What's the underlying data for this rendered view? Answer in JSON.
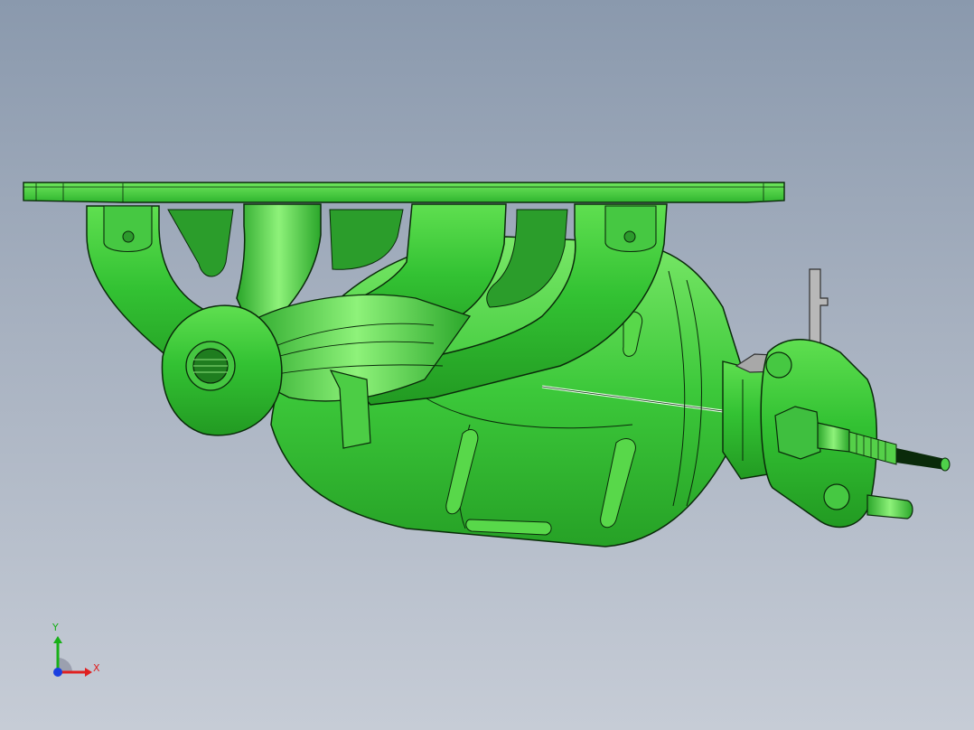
{
  "viewport": {
    "background_top": "#8a99ad",
    "background_bottom": "#c6ccd6"
  },
  "model": {
    "part": "exhaust-manifold-with-catalytic-converter",
    "body_color": "#33c233",
    "highlight_color": "#7dee6a",
    "edge_color": "#0a2a0a",
    "bracket_color": "#b8b8b8"
  },
  "triad": {
    "x_label": "X",
    "y_label": "Y",
    "x_color": "#e02020",
    "y_color": "#18b018",
    "z_color": "#1a3fe0"
  }
}
